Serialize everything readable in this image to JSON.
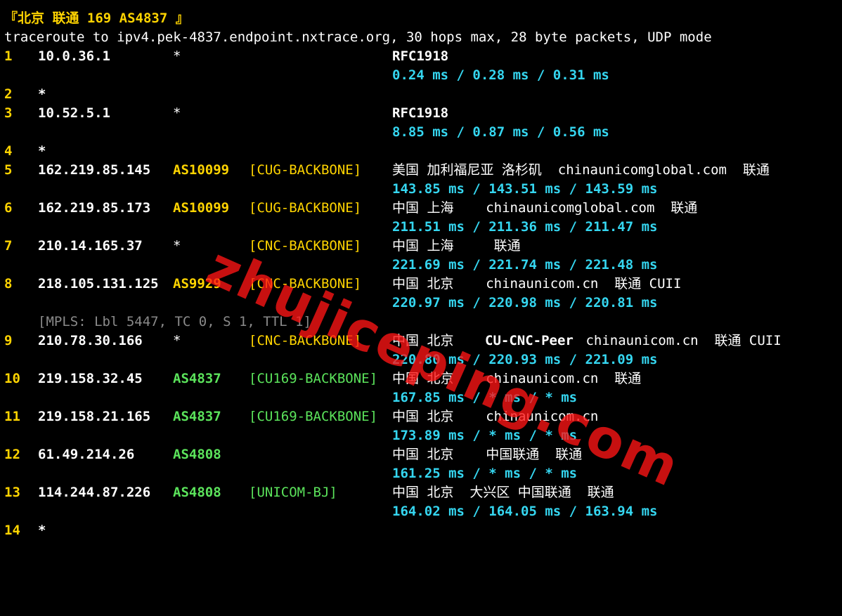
{
  "terminal": {
    "title": "『北京 联通 169 AS4837 』",
    "command": "traceroute to ipv4.pek-4837.endpoint.nxtrace.org, 30 hops max, 28 byte packets, UDP mode"
  },
  "hops": [
    {
      "num": "1",
      "ip": "10.0.36.1",
      "asn": "*",
      "tag": "",
      "geo": "RFC1918",
      "rtt": "0.24 ms / 0.28 ms / 0.31 ms"
    },
    {
      "num": "2",
      "ip": "*"
    },
    {
      "num": "3",
      "ip": "10.52.5.1",
      "asn": "*",
      "tag": "",
      "geo": "RFC1918",
      "rtt": "8.85 ms / 0.87 ms / 0.56 ms"
    },
    {
      "num": "4",
      "ip": "*"
    },
    {
      "num": "5",
      "ip": "162.219.85.145",
      "asn": "AS10099",
      "tag": "[CUG-BACKBONE]",
      "geo": "美国 加利福尼亚 洛杉矶  chinaunicomglobal.com  联通",
      "rtt": "143.85 ms / 143.51 ms / 143.59 ms"
    },
    {
      "num": "6",
      "ip": "162.219.85.173",
      "asn": "AS10099",
      "tag": "[CUG-BACKBONE]",
      "geo": "中国 上海    chinaunicomglobal.com  联通",
      "rtt": "211.51 ms / 211.36 ms / 211.47 ms"
    },
    {
      "num": "7",
      "ip": "210.14.165.37",
      "asn": "*",
      "tag": "[CNC-BACKBONE]",
      "geo": "中国 上海     联通",
      "rtt": "221.69 ms / 221.74 ms / 221.48 ms"
    },
    {
      "num": "8",
      "ip": "218.105.131.125",
      "asn": "AS9929",
      "tag": "[CNC-BACKBONE]",
      "geo": "中国 北京    chinaunicom.cn  联通 CUII",
      "rtt": "220.97 ms / 220.98 ms / 220.81 ms",
      "mpls": "[MPLS: Lbl 5447, TC 0, S 1, TTL 1]"
    },
    {
      "num": "9",
      "ip": "210.78.30.166",
      "asn": "*",
      "tag": "[CNC-BACKBONE]",
      "geo_a": "中国 北京  ",
      "geo_peer": "CU-CNC-Peer",
      "geo_b": " chinaunicom.cn  联通 CUII",
      "rtt": "220.80 ms / 220.93 ms / 221.09 ms"
    },
    {
      "num": "10",
      "ip": "219.158.32.45",
      "asn": "AS4837",
      "tag": "[CU169-BACKBONE]",
      "geo": "中国 北京    chinaunicom.cn  联通",
      "rtt": "167.85 ms / * ms / * ms"
    },
    {
      "num": "11",
      "ip": "219.158.21.165",
      "asn": "AS4837",
      "tag": "[CU169-BACKBONE]",
      "geo": "中国 北京    chinaunicom.cn",
      "rtt": "173.89 ms / * ms / * ms"
    },
    {
      "num": "12",
      "ip": "61.49.214.26",
      "asn": "AS4808",
      "tag": "",
      "geo": "中国 北京    中国联通  联通",
      "rtt": "161.25 ms / * ms / * ms"
    },
    {
      "num": "13",
      "ip": "114.244.87.226",
      "asn": "AS4808",
      "tag": "[UNICOM-BJ]",
      "geo": "中国 北京  大兴区 中国联通  联通",
      "rtt": "164.02 ms / 164.05 ms / 163.94 ms"
    },
    {
      "num": "14",
      "ip": "*"
    }
  ],
  "watermark": "zhujiceping.com",
  "colors": {
    "background": "#000000",
    "hop_number": "#ffd400",
    "asn_yellow": "#ffd400",
    "asn_green": "#5be35b",
    "rtt": "#35d6f0",
    "mpls": "#8a8a8a",
    "watermark": "#ff1414"
  }
}
